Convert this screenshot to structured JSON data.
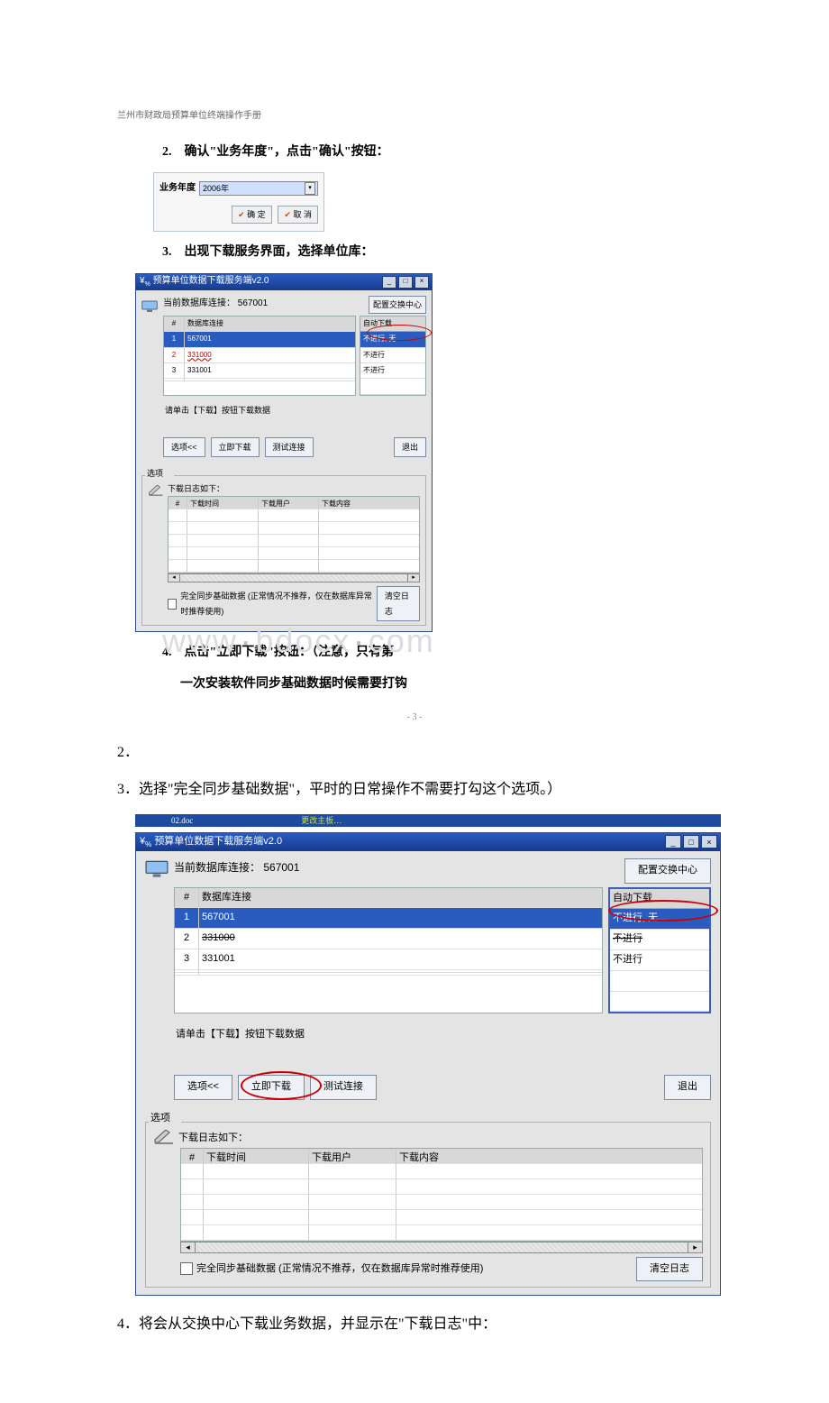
{
  "header": "兰州市财政局预算单位终端操作手册",
  "step2": "2.　确认\"业务年度\"，点击\"确认\"按钮：",
  "year_selector": {
    "label": "业务年度",
    "value": "2006年",
    "ok": "确 定",
    "cancel": "取 消"
  },
  "step3": "3.　出现下载服务界面，选择单位库：",
  "app": {
    "title": "预算单位数据下载服务端v2.0",
    "current_db": "当前数据库连接：",
    "current_db_val": "567001",
    "right_btn": "配置交换中心",
    "db_header_num": "#",
    "db_header_name": "数据库连接",
    "auto_header": "自动下载",
    "rows": [
      {
        "n": "1",
        "name": "567001",
        "auto": "不进行, 无..."
      },
      {
        "n": "2",
        "name": "331000",
        "auto": "不进行"
      },
      {
        "n": "3",
        "name": "331001",
        "auto": "不进行"
      }
    ],
    "hint": "请单击【下载】按钮下载数据",
    "btns": {
      "opt": "选项<<",
      "dl": "立即下载",
      "test": "测试连接",
      "exit": "退出"
    },
    "group": "选项",
    "log_title": "下载日志如下：",
    "log_headers": {
      "n": "#",
      "time": "下载时间",
      "user": "下载用户",
      "content": "下载内容"
    },
    "chk": "完全同步基础数据 (正常情况不推荐，仅在数据库异常时推荐使用)",
    "clear": "清空日志"
  },
  "step4_a": "4.　点击\"立即下载\"按钮：（注意，只有第",
  "step4_b": "一次安装软件同步基础数据时候需要打钩",
  "page_marker": "- 3 -",
  "para2": "2．",
  "para3": "3．选择\"完全同步基础数据\"，平时的日常操作不需要打勾这个选项。）",
  "para4": "4．将会从交换中心下载业务数据，并显示在\"下载日志\"中：",
  "strip": {
    "fname": "02.doc",
    "etc": "更改主板…"
  },
  "wm": {
    "a": "www",
    "b": "bdocx",
    "c": "com"
  }
}
